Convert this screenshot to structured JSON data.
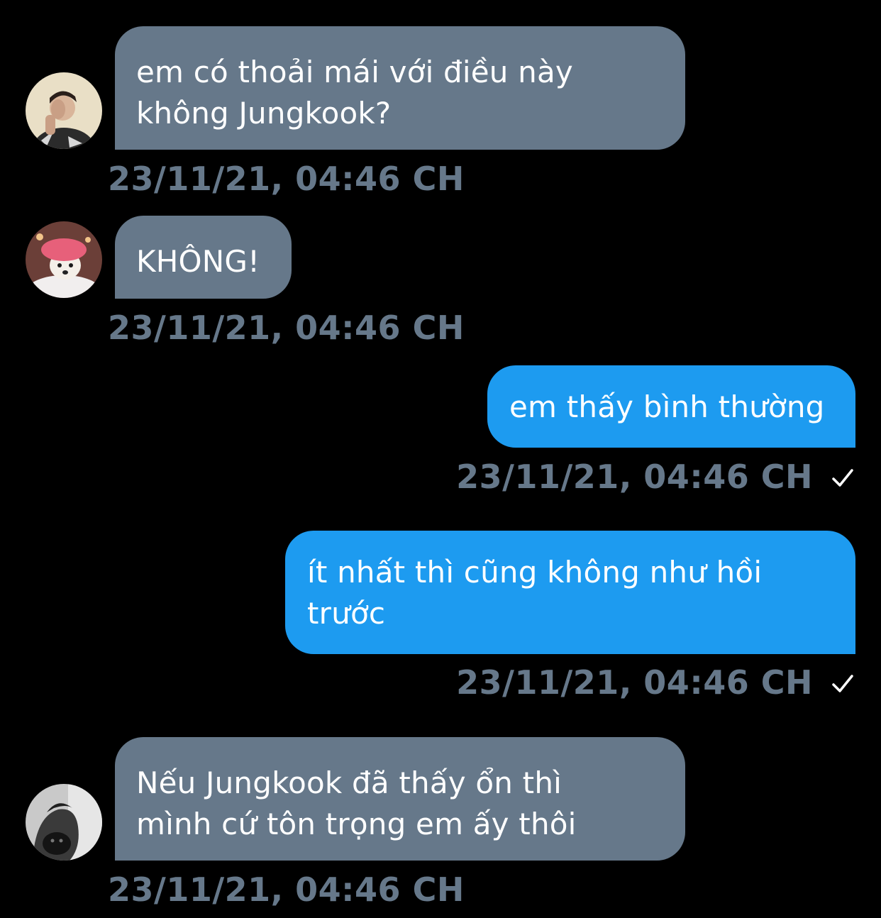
{
  "conversation": {
    "messages": [
      {
        "direction": "incoming",
        "avatar": "person-covering-face-avatar",
        "text": "em có thoải mái với điều này\nkhông Jungkook?",
        "timestamp": "23/11/21, 04:46 CH"
      },
      {
        "direction": "incoming",
        "avatar": "dog-with-pink-shower-cap-avatar",
        "text": "KHÔNG!",
        "timestamp": "23/11/21, 04:46 CH"
      },
      {
        "direction": "outgoing",
        "text": "em thấy bình thường",
        "timestamp": "23/11/21, 04:46 CH",
        "status_icon": "check-icon"
      },
      {
        "direction": "outgoing",
        "text": "ít nhất thì cũng không như hồi\ntrước",
        "timestamp": "23/11/21, 04:46 CH",
        "status_icon": "check-icon"
      },
      {
        "direction": "incoming",
        "avatar": "person-holding-pet-avatar",
        "text": "Nếu Jungkook đã thấy ổn thì\nmình cứ tôn trọng em ấy thôi",
        "timestamp": "23/11/21, 04:46 CH"
      }
    ]
  },
  "colors": {
    "background": "#000000",
    "incoming_bubble": "#66788a",
    "outgoing_bubble": "#1d9bf0",
    "timestamp": "#66788a",
    "text": "#ffffff"
  }
}
